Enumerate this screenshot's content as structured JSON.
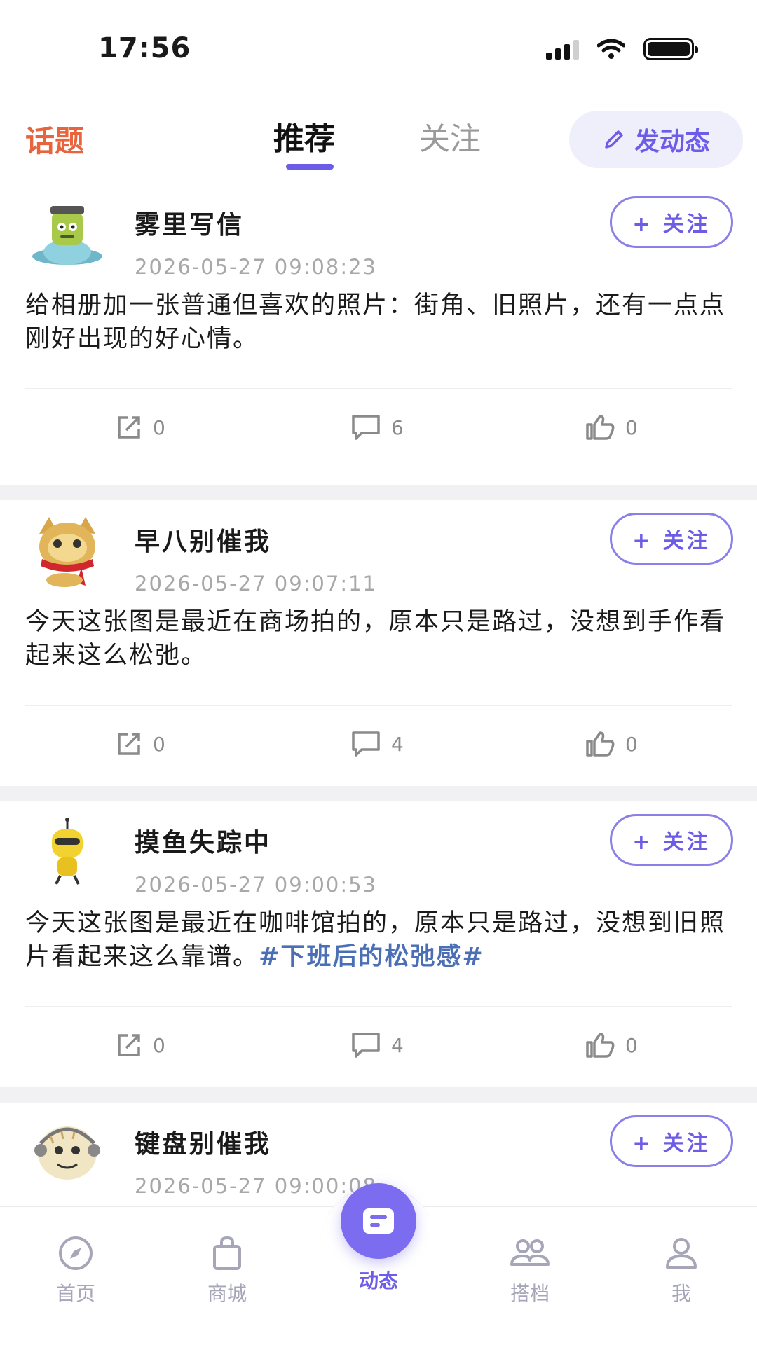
{
  "status_bar": {
    "time": "17:56"
  },
  "header": {
    "topic_label": "话题",
    "tabs": [
      {
        "label": "推荐",
        "active": true
      },
      {
        "label": "关注",
        "active": false
      }
    ],
    "post_button": "发动态"
  },
  "colors": {
    "accent": "#6c5ce7",
    "topic": "#e8643c",
    "hashtag": "#4a6fb5"
  },
  "posts": [
    {
      "username": "雾里写信",
      "timestamp": "2026-05-27 09:08:23",
      "follow_label": "+ 关注",
      "text": "给相册加一张普通但喜欢的照片：街角、旧照片，还有一点点刚好出现的好心情。",
      "hashtag": "",
      "shares": "0",
      "comments": "6",
      "likes": "0"
    },
    {
      "username": "早八别催我",
      "timestamp": "2026-05-27 09:07:11",
      "follow_label": "+ 关注",
      "text": "今天这张图是最近在商场拍的，原本只是路过，没想到手作看起来这么松弛。",
      "hashtag": "",
      "shares": "0",
      "comments": "4",
      "likes": "0"
    },
    {
      "username": "摸鱼失踪中",
      "timestamp": "2026-05-27 09:00:53",
      "follow_label": "+ 关注",
      "text": "今天这张图是最近在咖啡馆拍的，原本只是路过，没想到旧照片看起来这么靠谱。",
      "hashtag": "#下班后的松弛感#",
      "shares": "0",
      "comments": "4",
      "likes": "0"
    },
    {
      "username": "键盘别催我",
      "timestamp": "2026-05-27 09:00:08",
      "follow_label": "+ 关注",
      "text": "",
      "hashtag": "",
      "shares": "",
      "comments": "",
      "likes": ""
    }
  ],
  "bottom_nav": [
    {
      "label": "首页",
      "icon": "compass-icon"
    },
    {
      "label": "商城",
      "icon": "shopping-bag-icon"
    },
    {
      "label": "动态",
      "icon": "feed-icon",
      "active": true
    },
    {
      "label": "搭档",
      "icon": "partner-icon"
    },
    {
      "label": "我",
      "icon": "user-icon"
    }
  ]
}
